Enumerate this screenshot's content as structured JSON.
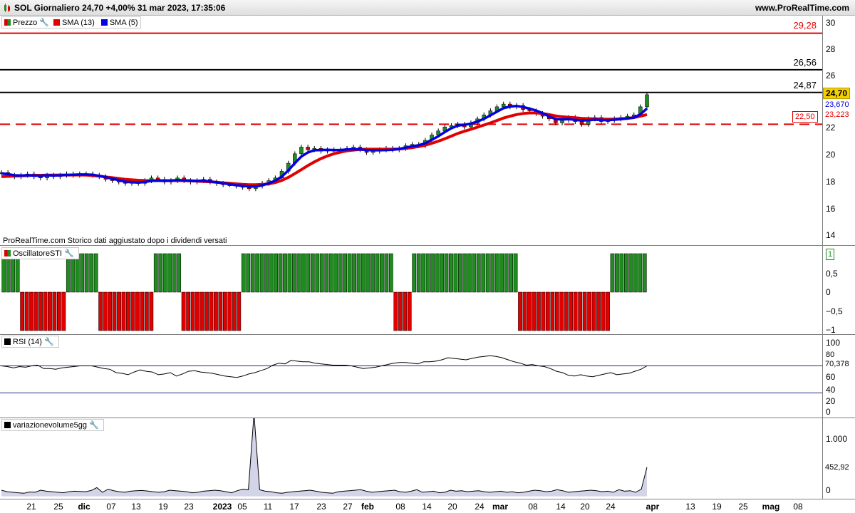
{
  "header": {
    "title": "SOL Giornaliero 24,70 +4,00% 31 mar 2023, 17:35:06",
    "site": "www.ProRealTime.com"
  },
  "price_panel": {
    "legend": [
      {
        "label": "Prezzo",
        "color": "#1e8c1e"
      },
      {
        "label": "SMA (13)",
        "color": "#e00000"
      },
      {
        "label": "SMA (5)",
        "color": "#0000e0"
      }
    ],
    "note": "ProRealTime.com  Storico dati aggiustato dopo i dividendi versati",
    "y_ticks": [
      "30",
      "28",
      "26",
      "24",
      "22",
      "20",
      "18",
      "16",
      "14"
    ],
    "levels": [
      {
        "value": "29,28",
        "color": "#e00000"
      },
      {
        "value": "26,56",
        "color": "#000000"
      },
      {
        "value": "24,87",
        "color": "#000000"
      },
      {
        "value": "22,50",
        "color": "#e00000"
      }
    ],
    "last_price": "24,70",
    "sma5_value": "23,670",
    "sma13_value": "23,223"
  },
  "oscillator_panel": {
    "legend": "OscillatoreSTI",
    "y_ticks": [
      "1",
      "0,5",
      "0",
      "−0,5",
      "−1"
    ]
  },
  "rsi_panel": {
    "legend": "RSI (14)",
    "y_ticks": [
      "100",
      "80",
      "60",
      "40",
      "20",
      "0"
    ],
    "current": "70,378"
  },
  "volume_panel": {
    "legend": "variazionevolume5gg",
    "y_ticks": [
      "1.000",
      "0"
    ],
    "current": "452,92"
  },
  "x_axis": {
    "ticks": [
      {
        "label": "21",
        "bold": false
      },
      {
        "label": "25",
        "bold": false
      },
      {
        "label": "dic",
        "bold": true
      },
      {
        "label": "07",
        "bold": false
      },
      {
        "label": "13",
        "bold": false
      },
      {
        "label": "19",
        "bold": false
      },
      {
        "label": "23",
        "bold": false
      },
      {
        "label": "2023",
        "bold": true
      },
      {
        "label": "05",
        "bold": false
      },
      {
        "label": "11",
        "bold": false
      },
      {
        "label": "17",
        "bold": false
      },
      {
        "label": "23",
        "bold": false
      },
      {
        "label": "27",
        "bold": false
      },
      {
        "label": "feb",
        "bold": true
      },
      {
        "label": "08",
        "bold": false
      },
      {
        "label": "14",
        "bold": false
      },
      {
        "label": "20",
        "bold": false
      },
      {
        "label": "24",
        "bold": false
      },
      {
        "label": "mar",
        "bold": true
      },
      {
        "label": "08",
        "bold": false
      },
      {
        "label": "14",
        "bold": false
      },
      {
        "label": "20",
        "bold": false
      },
      {
        "label": "24",
        "bold": false
      },
      {
        "label": "apr",
        "bold": true
      },
      {
        "label": "13",
        "bold": false
      },
      {
        "label": "19",
        "bold": false
      },
      {
        "label": "25",
        "bold": false
      },
      {
        "label": "mag",
        "bold": true
      },
      {
        "label": "08",
        "bold": false
      }
    ]
  },
  "chart_data": {
    "type": "line",
    "price_close": [
      18.9,
      18.7,
      18.6,
      18.7,
      18.8,
      18.6,
      18.5,
      18.7,
      18.6,
      18.7,
      18.8,
      18.7,
      18.8,
      18.8,
      18.7,
      18.6,
      18.4,
      18.3,
      18.2,
      18.1,
      18.2,
      18.1,
      18.3,
      18.5,
      18.4,
      18.2,
      18.3,
      18.5,
      18.3,
      18.2,
      18.3,
      18.4,
      18.2,
      18.1,
      18.0,
      18.0,
      17.9,
      17.8,
      17.7,
      17.9,
      18.1,
      18.3,
      18.5,
      19.0,
      19.6,
      20.3,
      20.8,
      20.6,
      20.7,
      20.5,
      20.6,
      20.5,
      20.6,
      20.7,
      20.8,
      20.6,
      20.4,
      20.5,
      20.6,
      20.7,
      20.6,
      20.7,
      20.9,
      21.0,
      20.9,
      21.3,
      21.7,
      22.0,
      22.3,
      22.4,
      22.5,
      22.3,
      22.6,
      22.9,
      23.2,
      23.5,
      23.8,
      24.0,
      23.8,
      23.9,
      23.6,
      23.5,
      23.3,
      23.1,
      22.9,
      22.6,
      22.8,
      23.0,
      22.7,
      22.5,
      22.9,
      23.0,
      22.7,
      22.8,
      22.9,
      23.0,
      23.1,
      23.2,
      23.8,
      24.7
    ],
    "sma5": [
      18.85,
      18.78,
      18.7,
      18.68,
      18.7,
      18.68,
      18.66,
      18.7,
      18.68,
      18.7,
      18.72,
      18.74,
      18.76,
      18.76,
      18.74,
      18.66,
      18.56,
      18.44,
      18.34,
      18.22,
      18.18,
      18.16,
      18.2,
      18.28,
      18.3,
      18.28,
      18.3,
      18.34,
      18.32,
      18.3,
      18.28,
      18.3,
      18.24,
      18.18,
      18.1,
      18.04,
      17.96,
      17.92,
      17.86,
      17.86,
      17.96,
      18.1,
      18.3,
      18.6,
      19.06,
      19.6,
      20.1,
      20.4,
      20.56,
      20.58,
      20.6,
      20.58,
      20.58,
      20.62,
      20.64,
      20.62,
      20.58,
      20.56,
      20.56,
      20.58,
      20.6,
      20.66,
      20.76,
      20.86,
      20.94,
      21.08,
      21.34,
      21.6,
      21.92,
      22.2,
      22.4,
      22.46,
      22.54,
      22.7,
      22.9,
      23.16,
      23.44,
      23.7,
      23.82,
      23.86,
      23.78,
      23.66,
      23.52,
      23.32,
      23.08,
      22.88,
      22.86,
      22.88,
      22.82,
      22.78,
      22.8,
      22.84,
      22.82,
      22.8,
      22.84,
      22.88,
      22.94,
      23.0,
      23.24,
      23.67
    ],
    "sma13": [
      18.6,
      18.62,
      18.64,
      18.66,
      18.68,
      18.7,
      18.7,
      18.71,
      18.71,
      18.72,
      18.72,
      18.72,
      18.72,
      18.71,
      18.68,
      18.64,
      18.58,
      18.52,
      18.46,
      18.4,
      18.36,
      18.33,
      18.31,
      18.3,
      18.3,
      18.3,
      18.3,
      18.3,
      18.3,
      18.28,
      18.26,
      18.24,
      18.22,
      18.18,
      18.14,
      18.1,
      18.06,
      18.02,
      18.0,
      18.0,
      18.02,
      18.06,
      18.16,
      18.32,
      18.54,
      18.82,
      19.12,
      19.42,
      19.7,
      19.94,
      20.14,
      20.3,
      20.42,
      20.52,
      20.58,
      20.62,
      20.64,
      20.64,
      20.64,
      20.64,
      20.64,
      20.66,
      20.7,
      20.76,
      20.84,
      20.94,
      21.08,
      21.24,
      21.42,
      21.62,
      21.82,
      21.98,
      22.12,
      22.28,
      22.44,
      22.6,
      22.78,
      22.96,
      23.1,
      23.22,
      23.3,
      23.34,
      23.34,
      23.3,
      23.22,
      23.12,
      23.06,
      23.02,
      22.98,
      22.94,
      22.92,
      22.9,
      22.88,
      22.88,
      22.88,
      22.9,
      22.94,
      23.0,
      23.1,
      23.22
    ],
    "oscillator": [
      1,
      1,
      1,
      1,
      -1,
      -1,
      -1,
      -1,
      -1,
      -1,
      -1,
      -1,
      -1,
      -1,
      1,
      1,
      1,
      1,
      1,
      1,
      1,
      -1,
      -1,
      -1,
      -1,
      -1,
      -1,
      -1,
      -1,
      -1,
      -1,
      -1,
      -1,
      1,
      1,
      1,
      1,
      1,
      1,
      -1,
      -1,
      -1,
      -1,
      -1,
      -1,
      -1,
      -1,
      -1,
      -1,
      -1,
      -1,
      -1,
      1,
      1,
      1,
      1,
      1,
      1,
      1,
      1,
      1,
      1,
      1,
      1,
      1,
      1,
      1,
      1,
      1,
      1,
      1,
      1,
      1,
      1,
      1,
      1,
      1,
      1,
      1,
      1,
      1,
      1,
      1,
      1,
      1,
      -1,
      -1,
      -1,
      -1,
      1,
      1,
      1,
      1,
      1,
      1,
      1,
      1,
      1,
      1,
      1,
      1,
      1,
      1,
      1,
      1,
      1,
      1,
      1,
      1,
      1,
      1,
      1,
      -1,
      -1,
      -1,
      -1,
      -1,
      -1,
      -1,
      -1,
      -1,
      -1,
      -1,
      -1,
      -1,
      -1,
      -1,
      -1,
      -1,
      -1,
      -1,
      -1,
      1,
      1,
      1,
      1,
      1,
      1,
      1,
      1
    ],
    "rsi": [
      70,
      69,
      67,
      69,
      68,
      70,
      71,
      66,
      66,
      65,
      67,
      68,
      69,
      70,
      70,
      70,
      68,
      66,
      65,
      60,
      59,
      57,
      61,
      64,
      62,
      61,
      57,
      58,
      60,
      55,
      58,
      62,
      63,
      61,
      60,
      59,
      57,
      55,
      54,
      53,
      55,
      58,
      60,
      63,
      66,
      71,
      74,
      73,
      78,
      77,
      76,
      76,
      74,
      73,
      72,
      71,
      71,
      71,
      70,
      68,
      66,
      67,
      68,
      70,
      72,
      74,
      75,
      75,
      74,
      73,
      76,
      76,
      77,
      79,
      82,
      81,
      80,
      79,
      81,
      83,
      84,
      85,
      84,
      82,
      79,
      76,
      74,
      71,
      72,
      70,
      69,
      66,
      62,
      60,
      56,
      55,
      57,
      55,
      54,
      56,
      58,
      60,
      57,
      58,
      59,
      62,
      65,
      70
    ],
    "volume": [
      0,
      -30,
      -40,
      -50,
      -60,
      -35,
      -40,
      0,
      -20,
      -30,
      -40,
      -50,
      -30,
      -20,
      -25,
      -30,
      -5,
      50,
      -40,
      20,
      -10,
      -30,
      -40,
      -20,
      -10,
      -5,
      -15,
      -30,
      -40,
      -30,
      0,
      -10,
      -20,
      -30,
      -50,
      -40,
      -20,
      -10,
      0,
      -10,
      -30,
      -50,
      -10,
      20,
      10,
      1500,
      10,
      -20,
      -30,
      -50,
      -60,
      -40,
      -30,
      -20,
      -10,
      0,
      -20,
      -40,
      -50,
      -60,
      -30,
      -20,
      -10,
      0,
      10,
      -20,
      -40,
      -30,
      -20,
      -10,
      0,
      -30,
      -40,
      -20,
      10,
      -40,
      -30,
      -20,
      -50,
      -40,
      0,
      -20,
      -10,
      -30,
      -20,
      -10,
      -30,
      -40,
      -30,
      -20,
      -40,
      -30,
      -50,
      -40,
      -20,
      0,
      -10,
      -30,
      -20,
      10,
      -10,
      -40,
      -30,
      -20,
      -10,
      0,
      -10,
      -30,
      -20,
      -40,
      10,
      -20,
      -10,
      -40,
      20,
      452
    ]
  }
}
